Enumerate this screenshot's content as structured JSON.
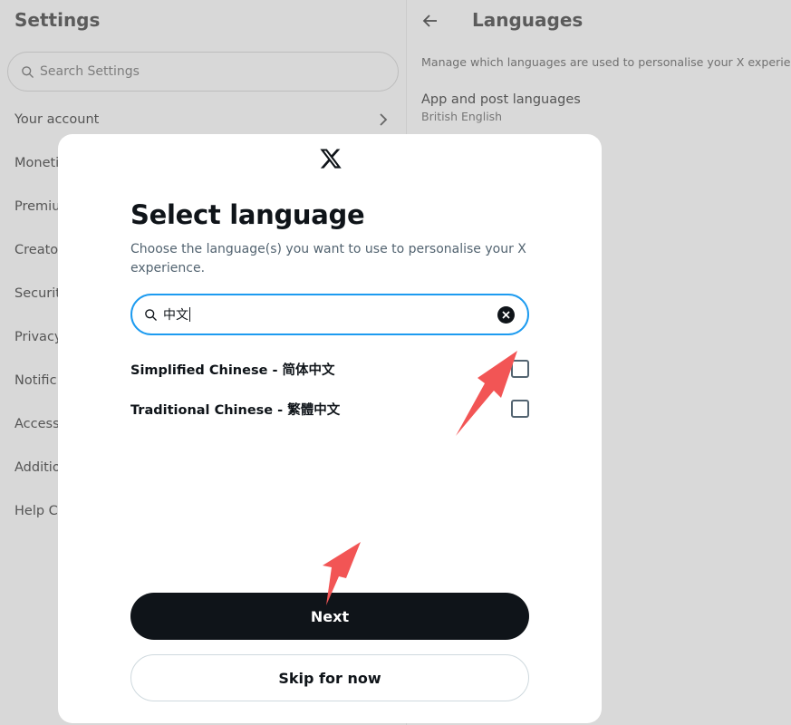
{
  "settings": {
    "title": "Settings",
    "search_placeholder": "Search Settings",
    "menu": [
      "Your account",
      "Moneti",
      "Premiu",
      "Creato",
      "Securit",
      "Privacy",
      "Notific",
      "Access",
      "Additio",
      "Help Ce"
    ]
  },
  "languages_panel": {
    "title": "Languages",
    "description": "Manage which languages are used to personalise your X experience.",
    "app_post_label": "App and post languages",
    "app_post_value": "British English"
  },
  "modal": {
    "title": "Select language",
    "description": "Choose the language(s) you want to use to personalise your X experience.",
    "search_value": "中文",
    "options": [
      {
        "label": "Simplified Chinese - 简体中文",
        "checked": false
      },
      {
        "label": "Traditional Chinese - 繁體中文",
        "checked": false
      }
    ],
    "next_label": "Next",
    "skip_label": "Skip for now"
  },
  "colors": {
    "accent": "#1d9bf0",
    "annotation_arrow": "#f25555",
    "primary_button": "#0f1419"
  }
}
